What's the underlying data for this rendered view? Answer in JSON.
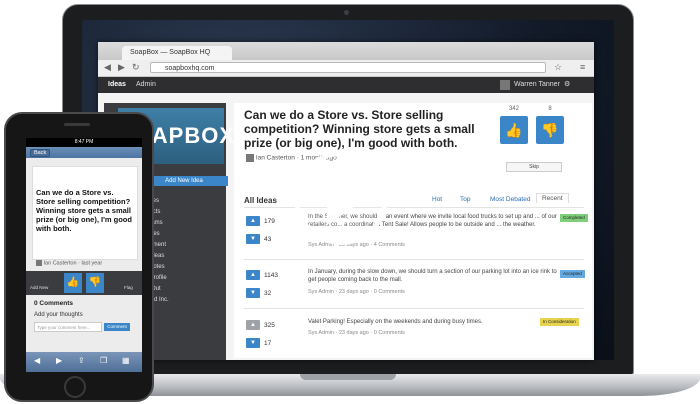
{
  "browser": {
    "tab_title": "SoapBox — SoapBox HQ",
    "url": "soapboxhq.com"
  },
  "app": {
    "nav_ideas": "Ideas",
    "nav_admin": "Admin",
    "user_name": "Warren Tanner",
    "logo_text": "SOAPBOX",
    "add_idea_button": "Add New Idea",
    "sidebar_items": [
      "ories",
      "ducts",
      "grams",
      "vices",
      "gement",
      "r Ideas",
      "r Votes",
      "r Profile",
      "n Out",
      "lend Inc."
    ]
  },
  "featured": {
    "question": "Can we do a Store vs. Store selling competition? Winning store gets a small prize (or big one), I'm good with both.",
    "author": "Ian Casterton",
    "time": "1 month ago",
    "up_count": "342",
    "down_count": "8",
    "skip_label": "Skip"
  },
  "list": {
    "heading": "All Ideas",
    "sort_tabs": [
      "Hot",
      "Top",
      "Most Debated",
      "Recent"
    ],
    "ideas": [
      {
        "up": "179",
        "down": "43",
        "text": "In the Summer, we should ... an event where we invite local food trucks to set up and ... of our retailers co... a coordinated Tent Sale! Allows people to be outside and ... the weather.",
        "meta": "Sys Admin · 23 days ago · 4 Comments",
        "status": "Completed"
      },
      {
        "up": "1143",
        "down": "32",
        "text": "In January, during the slow down, we should turn a section of our parking lot into an ice rink to get people coming back to the mall.",
        "meta": "Sys Admin · 23 days ago · 0 Comments",
        "status": "Accepted"
      },
      {
        "up": "325",
        "down": "17",
        "text": "Valet Parking! Especially on the weekends and during busy times.",
        "meta": "Sys Admin · 23 days ago · 0 Comments",
        "status": "In Consideration"
      }
    ]
  },
  "phone": {
    "time": "8:47 PM",
    "back_label": "Back",
    "question": "Can we do a Store vs. Store selling competition? Winning store gets a small prize (or big one), I'm good with both.",
    "author": "Ian Casterton",
    "time_ago": "last year",
    "add_new": "Add New",
    "flag": "Flag",
    "comments_heading": "0 Comments",
    "thoughts_label": "Add your thoughts",
    "input_placeholder": "Type your comment here...",
    "comment_button": "Comment"
  },
  "colors": {
    "accent_blue": "#3a86c8",
    "appbar": "#2e2e30",
    "status_completed": "#7fcf7a",
    "status_accepted": "#64a9e0",
    "status_consideration": "#e8d34e"
  }
}
